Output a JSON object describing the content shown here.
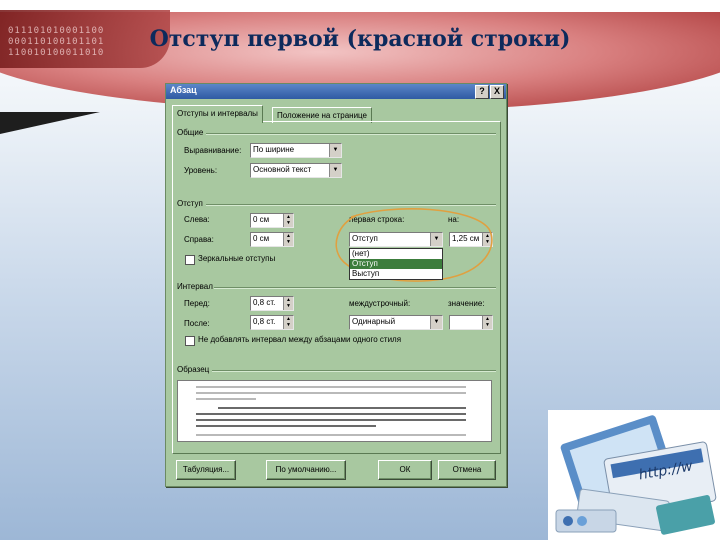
{
  "slide": {
    "title": "Отступ первой (красной строки)"
  },
  "banner": {
    "binary_rows": [
      "011101010001100",
      "000110100101101",
      "110010100011010"
    ]
  },
  "dialog": {
    "title": "Абзац",
    "titlebar_buttons": [
      "?",
      "X"
    ],
    "tabs": [
      "Отступы и интервалы",
      "Положение на странице"
    ],
    "general": {
      "heading": "Общие",
      "alignment_label": "Выравнивание:",
      "alignment_value": "По ширине",
      "level_label": "Уровень:",
      "level_value": "Основной текст"
    },
    "indent": {
      "heading": "Отступ",
      "left_label": "Слева:",
      "left_value": "0 см",
      "right_label": "Справа:",
      "right_value": "0 см",
      "first_line_label": "первая строка:",
      "first_line_value": "Отступ",
      "by_label": "на:",
      "by_value": "1,25 см",
      "first_line_options": [
        "(нет)",
        "Отступ",
        "Выступ"
      ],
      "first_line_selected_index": 1,
      "mirror_label": "Зеркальные отступы"
    },
    "spacing": {
      "heading": "Интервал",
      "before_label": "Перед:",
      "before_value": "0,8 ст.",
      "after_label": "После:",
      "after_value": "0,8 ст.",
      "line_label": "междустрочный:",
      "line_value": "Одинарный",
      "at_label": "значение:",
      "at_value": "",
      "no_space_label": "Не добавлять интервал между абзацами одного стиля"
    },
    "sample": {
      "heading": "Образец"
    },
    "buttons": {
      "tabs": "Табуляция...",
      "default": "По умолчанию...",
      "ok": "ОК",
      "cancel": "Отмена"
    }
  },
  "colors": {
    "dialog_bg": "#a8c8a0",
    "title_text": "#0d2a5c",
    "annotation": "#e0a040",
    "selected_option": "#3c7d3c"
  },
  "icons": [
    "help-icon",
    "close-icon",
    "dropdown-arrow-icon",
    "spin-up-icon",
    "spin-down-icon",
    "internet-illustration"
  ]
}
